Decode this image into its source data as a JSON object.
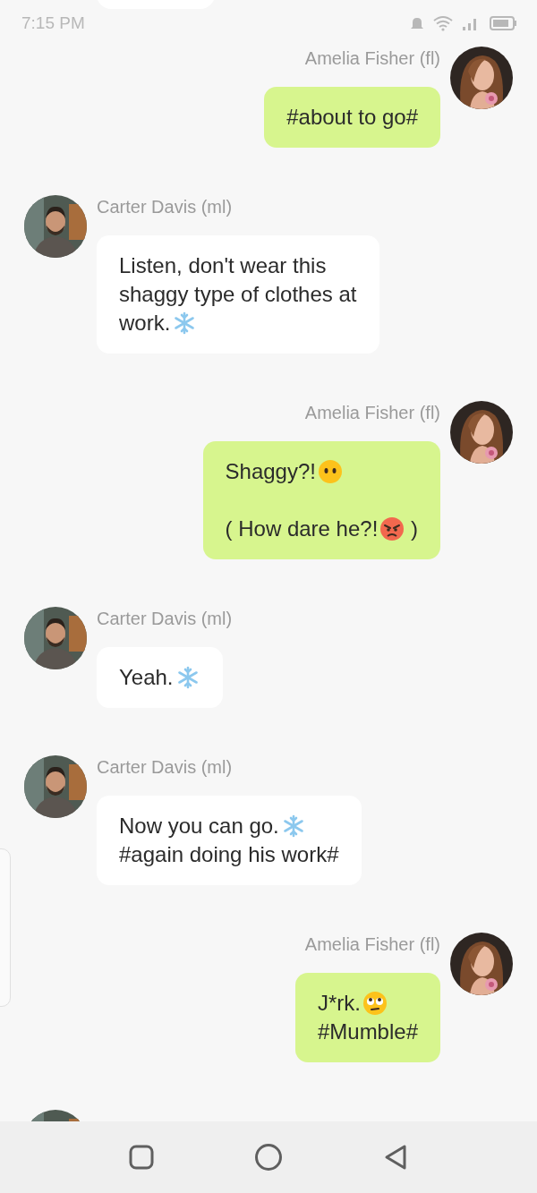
{
  "status_bar": {
    "time": "7:15 PM"
  },
  "messages": [
    {
      "sender": "Amelia Fisher (fl)",
      "outgoing": true,
      "paragraphs": [
        {
          "lines": [
            {
              "text": "#about to go#"
            }
          ]
        }
      ]
    },
    {
      "sender": "Carter Davis (ml)",
      "outgoing": false,
      "paragraphs": [
        {
          "lines": [
            {
              "text": "Listen, don't wear this"
            },
            {
              "text": "shaggy type of clothes at"
            },
            {
              "text": "work.",
              "kind": "snowflake"
            }
          ]
        }
      ]
    },
    {
      "sender": "Amelia Fisher (fl)",
      "outgoing": true,
      "paragraphs": [
        {
          "lines": [
            {
              "text": "Shaggy?!",
              "kind": "speechless"
            }
          ]
        },
        {
          "lines": [
            {
              "text": "( How dare he?!",
              "kind": "angry",
              "tail": " )"
            }
          ]
        }
      ]
    },
    {
      "sender": "Carter Davis (ml)",
      "outgoing": false,
      "paragraphs": [
        {
          "lines": [
            {
              "text": "Yeah.",
              "kind": "snowflake"
            }
          ]
        }
      ]
    },
    {
      "sender": "Carter Davis (ml)",
      "outgoing": false,
      "paragraphs": [
        {
          "lines": [
            {
              "text": "Now you can go.",
              "kind": "snowflake"
            },
            {
              "text": "#again doing his work#"
            }
          ]
        }
      ]
    },
    {
      "sender": "Amelia Fisher (fl)",
      "outgoing": true,
      "paragraphs": [
        {
          "lines": [
            {
              "text": "J*rk.",
              "kind": "eye-roll"
            },
            {
              "text": "#Mumble#"
            }
          ]
        }
      ]
    }
  ],
  "partial_next": {
    "outgoing": false
  }
}
